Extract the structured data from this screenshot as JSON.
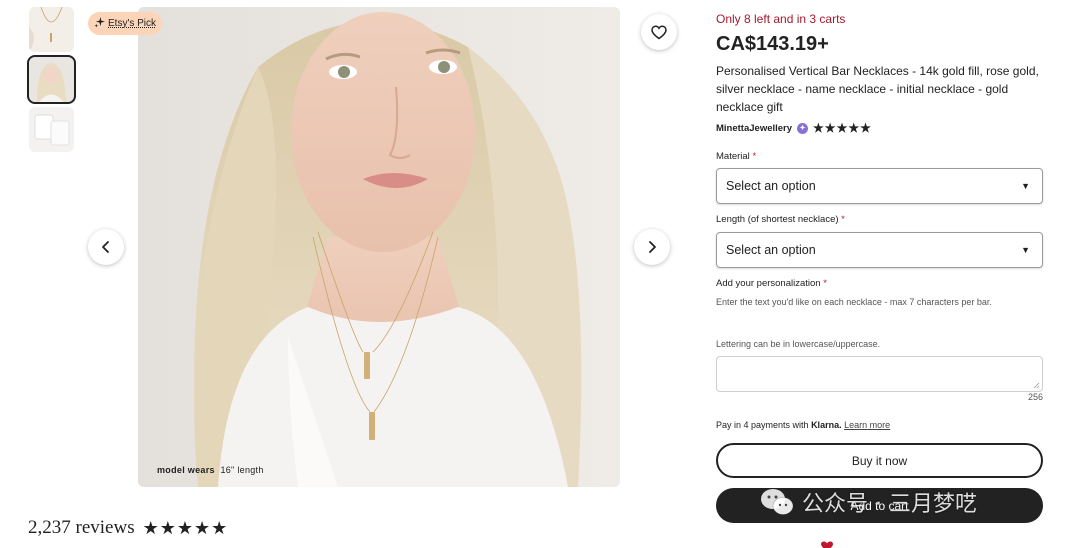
{
  "thumbnails": [
    {
      "alt": "thumbnail-1"
    },
    {
      "alt": "thumbnail-2"
    },
    {
      "alt": "thumbnail-3"
    }
  ],
  "badge": {
    "label": "Etsy's Pick"
  },
  "image": {
    "caption_bold": "model wears",
    "caption_rest": "16\" length"
  },
  "reviews": {
    "count": "2,237 reviews",
    "stars": "★★★★★"
  },
  "listing": {
    "stock": "Only 8 left and in 3 carts",
    "price": "CA$143.19+",
    "title": "Personalised Vertical Bar Necklaces - 14k gold fill, rose gold, silver necklace - name necklace - initial necklace - gold necklace gift",
    "shop": "MinettaJewellery",
    "shop_stars": "★★★★★"
  },
  "form": {
    "material_label": "Material",
    "material_value": "Select an option",
    "length_label": "Length (of shortest necklace)",
    "length_value": "Select an option",
    "personalization_label": "Add your personalization",
    "personalization_help": "Enter the text you'd like on each necklace - max 7 characters per bar.",
    "lettering_help": "Lettering can be in lowercase/uppercase.",
    "char_counter": "256",
    "required_mark": "*"
  },
  "payment": {
    "prefix": "Pay in 4 payments with",
    "brand": "Klarna.",
    "link": "Learn more"
  },
  "actions": {
    "buy_now": "Buy it now",
    "add_to_cart": "Add to cart"
  },
  "watermark": {
    "text": "公众号 · 三月梦呓"
  },
  "colors": {
    "stock_red": "#a61a2e",
    "badge_bg": "#fcd4b8",
    "cart_bg": "#222222"
  }
}
